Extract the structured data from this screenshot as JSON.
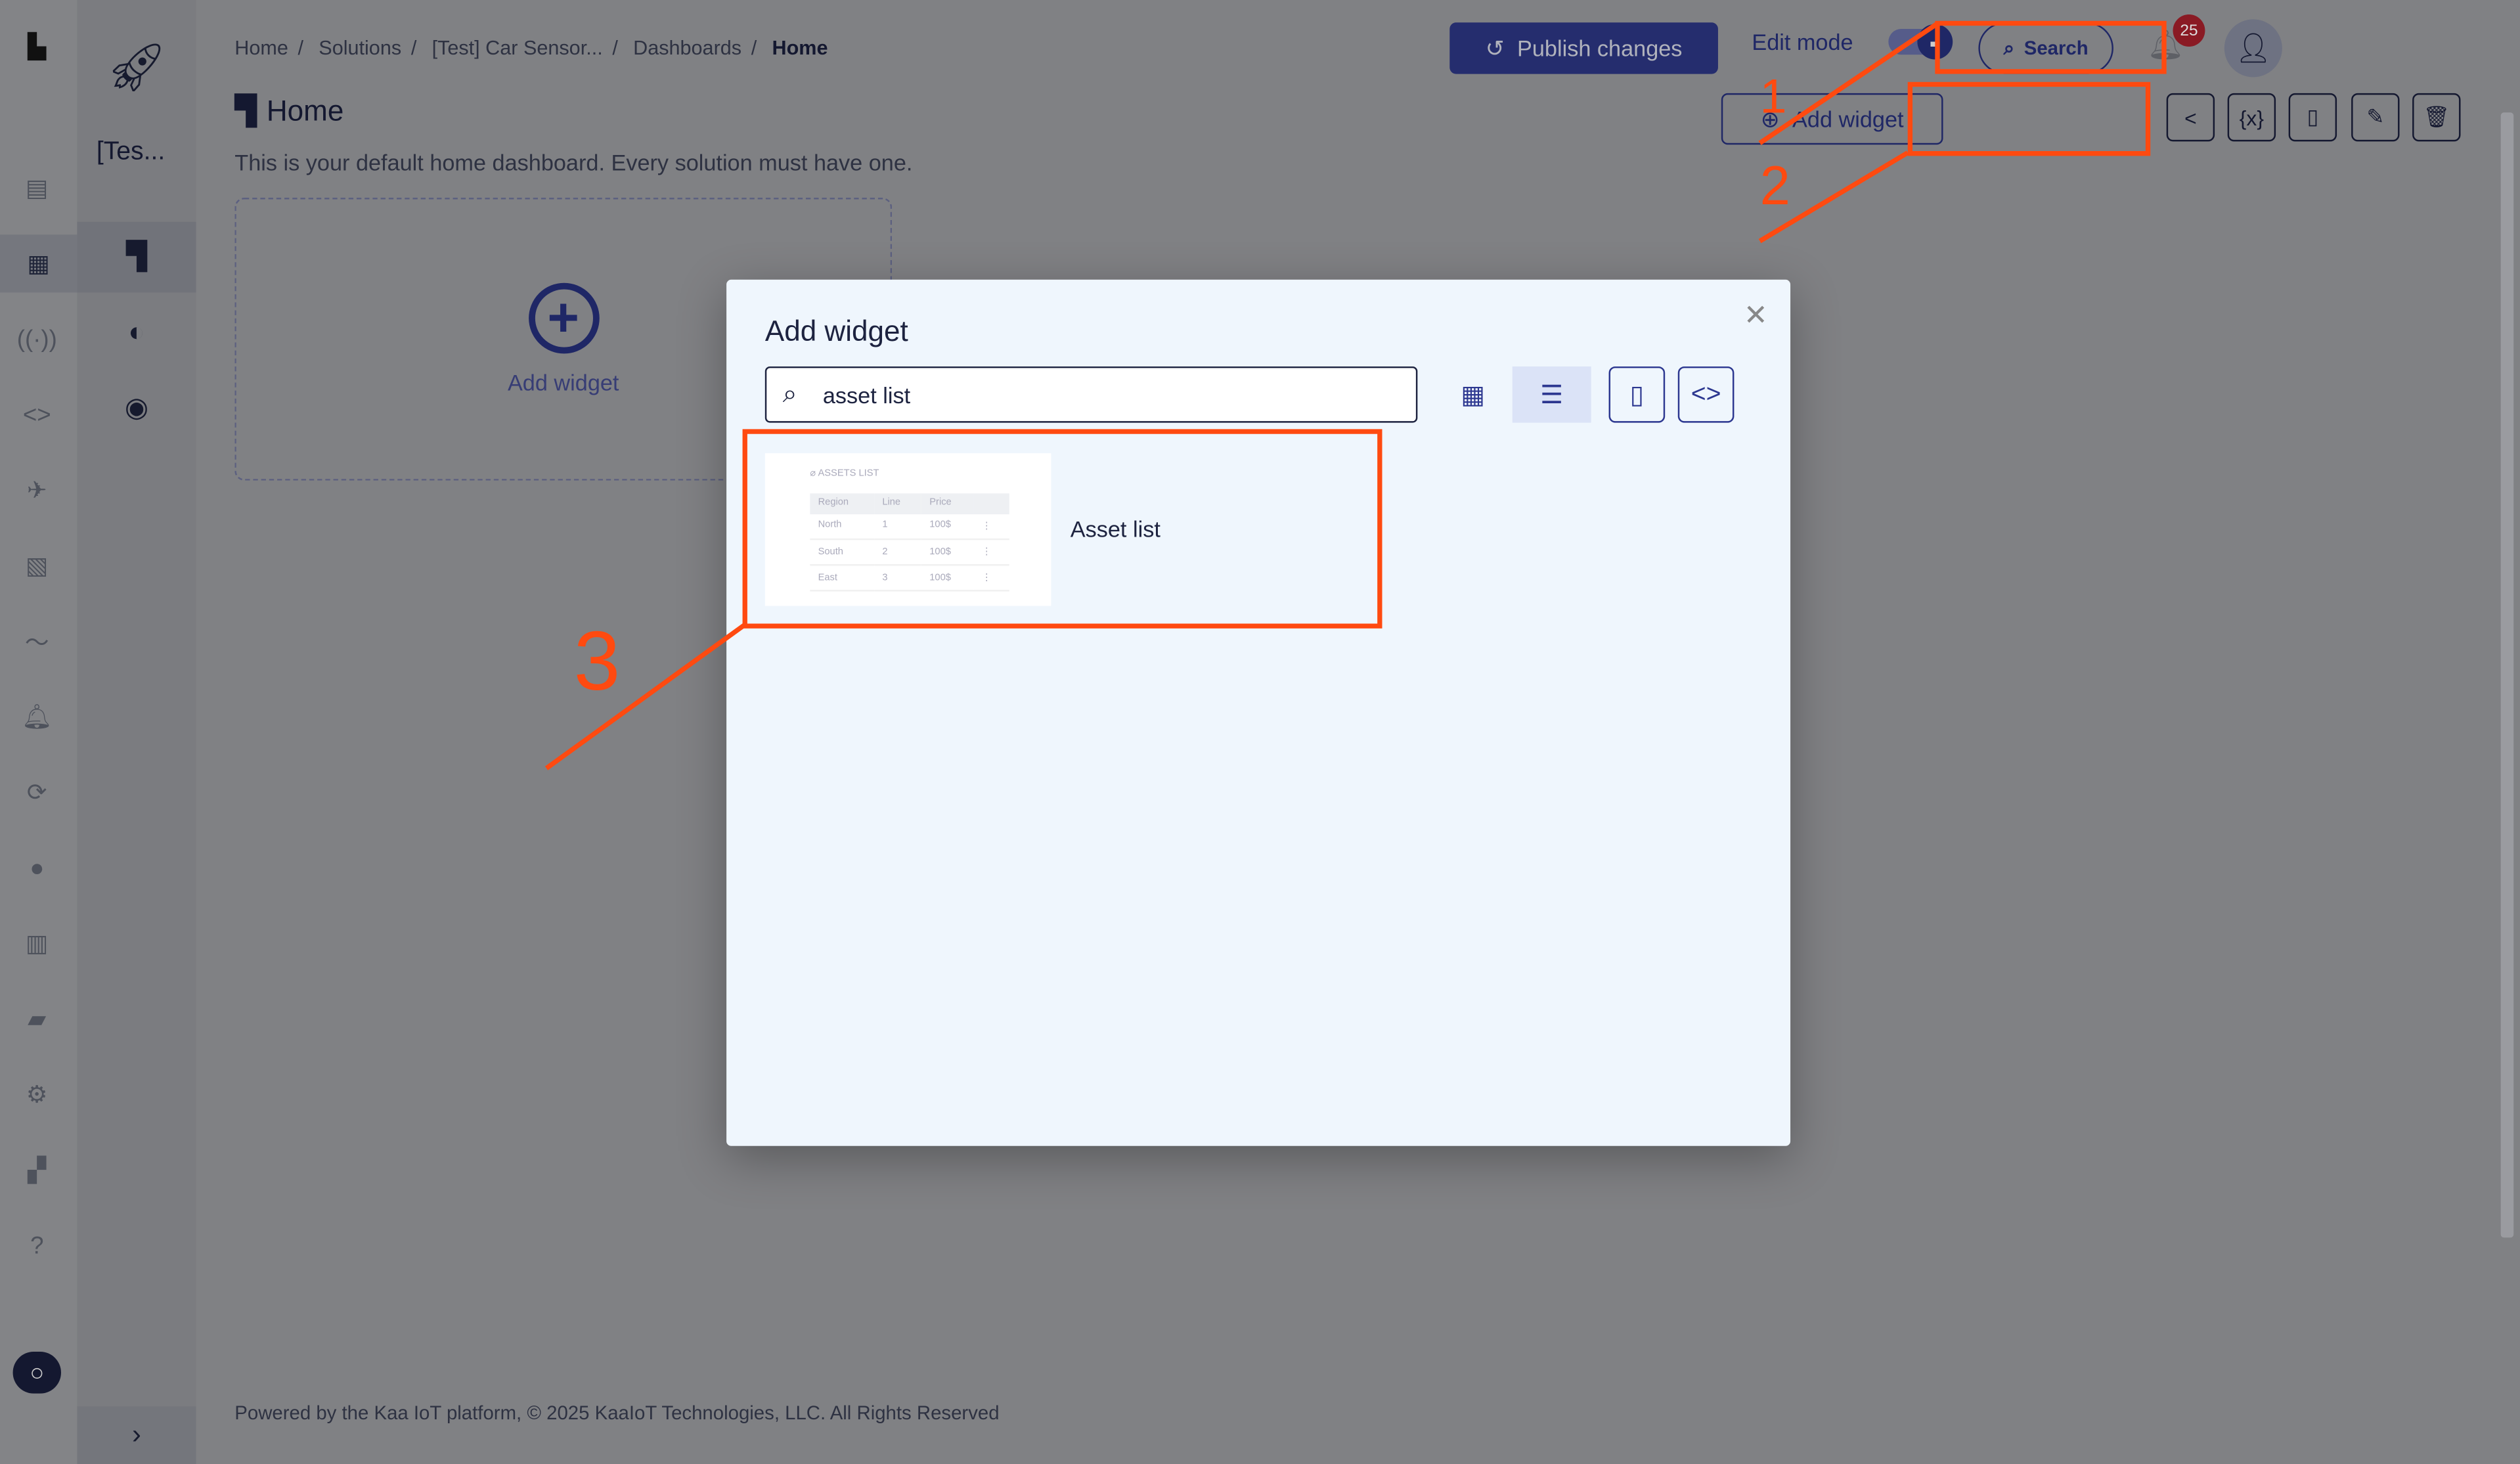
{
  "sidebar": {
    "solution_name": "[Tes...",
    "chat_icon": "chat-bubble-icon",
    "collapse_icon": "chevron-right-icon"
  },
  "breadcrumb": [
    "Home",
    "Solutions",
    "[Test] Car Sensor...",
    "Dashboards",
    "Home"
  ],
  "page": {
    "title": "Home",
    "description": "This is your default home dashboard. Every solution must have one.",
    "placeholder_label": "Add widget"
  },
  "header": {
    "publish_label": "Publish changes",
    "edit_mode_label": "Edit mode",
    "edit_mode_on": true,
    "search_label": "Search",
    "notification_count": "25"
  },
  "toolbar": {
    "add_widget_label": "Add widget"
  },
  "footer": "Powered by the Kaa IoT platform, © 2025 KaaIoT Technologies, LLC. All Rights Reserved",
  "modal": {
    "title": "Add widget",
    "search_value": "asset list",
    "result": {
      "label": "Asset list",
      "preview": {
        "title": "ASSETS LIST",
        "columns": [
          "Region",
          "Line",
          "Price"
        ],
        "rows": [
          [
            "North",
            "1",
            "100$"
          ],
          [
            "South",
            "2",
            "100$"
          ],
          [
            "East",
            "3",
            "100$"
          ]
        ]
      }
    }
  },
  "annotations": {
    "color": "#ff4a10",
    "steps": [
      "1",
      "2",
      "3"
    ]
  },
  "colors": {
    "primary": "#2c3790",
    "badge": "#c0202e"
  }
}
